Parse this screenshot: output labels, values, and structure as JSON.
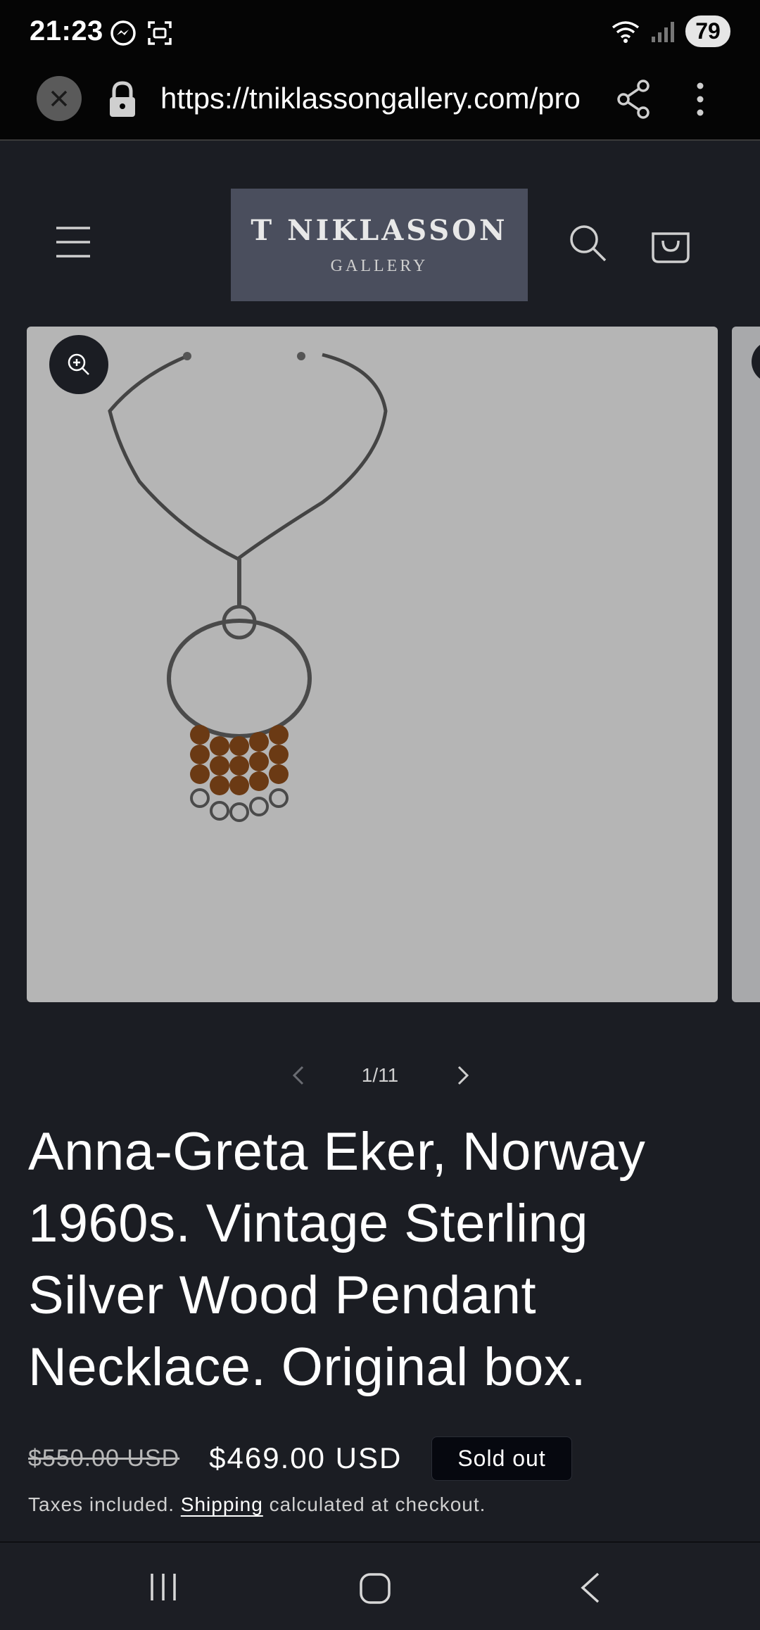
{
  "status_bar": {
    "time": "21:23",
    "battery": "79",
    "icons_left": [
      "messenger-icon",
      "screenshot-icon"
    ],
    "icons_right": [
      "wifi-icon",
      "signal-icon"
    ]
  },
  "browser": {
    "url": "https://tniklassongallery.com/pro"
  },
  "header": {
    "logo_main": "T NIKLASSON",
    "logo_sub": "GALLERY"
  },
  "gallery": {
    "counter": "1/11",
    "image_bg": "#b5b5b5"
  },
  "product": {
    "title": "Anna-Greta Eker, Norway 1960s. Vintage Sterling Silver Wood Pendant Necklace. Original box.",
    "price_old": "$550.00 USD",
    "price_new": "$469.00 USD",
    "badge": "Sold out",
    "taxes_prefix": "Taxes included.",
    "shipping_link": "Shipping",
    "taxes_suffix": "calculated at checkout."
  },
  "colors": {
    "background": "#1b1d23",
    "logo_bg": "#4a4e5d",
    "badge_bg": "#06080f"
  }
}
